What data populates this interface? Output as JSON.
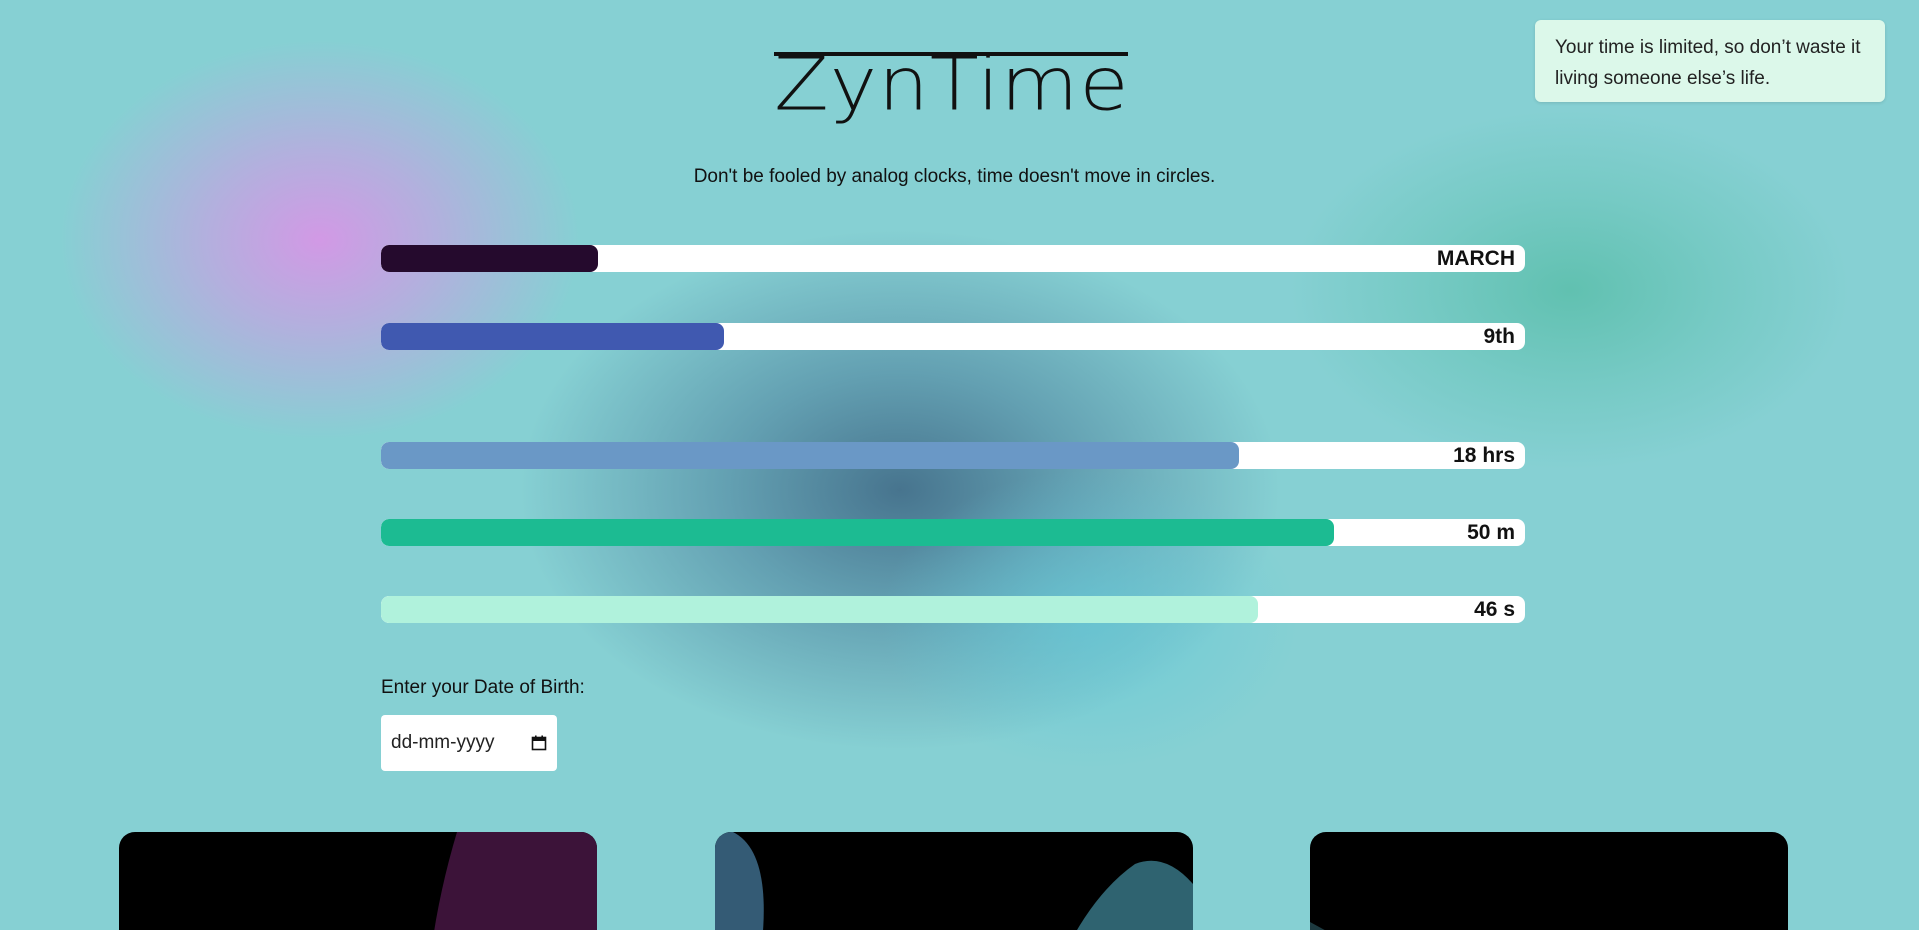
{
  "app": {
    "logo_text": "ZynTime",
    "tagline": "Don't be fooled by analog clocks, time doesn't move in circles.",
    "quote": "Your time is limited, so don’t waste it living someone else’s life."
  },
  "progress_bars": [
    {
      "label": "MARCH",
      "progress": 0.19,
      "color": "#250a2d"
    },
    {
      "label": "9th",
      "progress": 0.3,
      "color": "#4059b0"
    },
    {
      "label": "18 hrs",
      "progress": 0.75,
      "color": "#6a98c6"
    },
    {
      "label": "50 m",
      "progress": 0.833,
      "color": "#1cbb92"
    },
    {
      "label": "46 s",
      "progress": 0.767,
      "color": "#b0f2dc"
    }
  ],
  "dob": {
    "label": "Enter your Date of Birth:",
    "placeholder": "dd-mm-yyyy",
    "icon": "calendar-icon"
  },
  "colors": {
    "background": "#86d0d3",
    "quote_bg": "#dcf8ea",
    "card_bg": "#000000"
  }
}
